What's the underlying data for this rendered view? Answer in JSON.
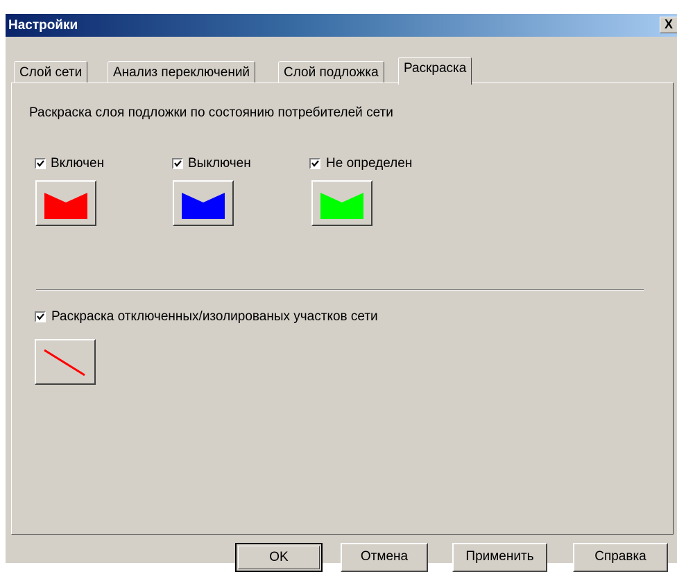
{
  "window": {
    "title": "Настройки",
    "close_glyph": "X"
  },
  "tabs": [
    {
      "label": "Слой сети"
    },
    {
      "label": "Анализ переключений"
    },
    {
      "label": "Слой подложка"
    },
    {
      "label": "Раскраска"
    }
  ],
  "active_tab": "Раскраска",
  "panel": {
    "section_label": "Раскраска слоя подложки по состоянию потребителей сети",
    "states": [
      {
        "label": "Включен",
        "checked": true,
        "color": "#ff0000"
      },
      {
        "label": "Выключен",
        "checked": true,
        "color": "#0000ff"
      },
      {
        "label": "Не определен",
        "checked": true,
        "color": "#00ff00"
      }
    ],
    "isolated": {
      "label": "Раскраска отключенных/изолированых участков сети",
      "checked": true,
      "line_color": "#ff0000"
    }
  },
  "buttons": {
    "ok": "OK",
    "cancel": "Отмена",
    "apply": "Применить",
    "help": "Справка"
  }
}
